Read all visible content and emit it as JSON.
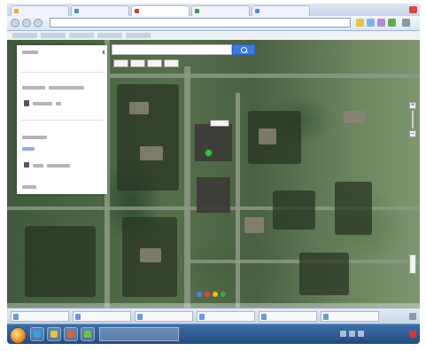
{
  "browser": {
    "tabs": [
      {
        "label": ""
      },
      {
        "label": ""
      },
      {
        "label": ""
      },
      {
        "label": ""
      },
      {
        "label": ""
      }
    ],
    "address": "",
    "accent": "#3c7ae0"
  },
  "map": {
    "search": {
      "placeholder": "",
      "value": ""
    },
    "map_types": [
      "",
      "",
      "",
      ""
    ],
    "label_tag": "",
    "marker_color": "#33c341",
    "zoom_in": "+",
    "zoom_out": "−"
  },
  "side_panel": {
    "header": "",
    "section1_title": "",
    "section1_item": "",
    "section2_title": "",
    "section2_link": "",
    "section2_item": "",
    "footer": ""
  },
  "downloads": [
    {
      "label": ""
    },
    {
      "label": ""
    },
    {
      "label": ""
    },
    {
      "label": ""
    },
    {
      "label": ""
    },
    {
      "label": ""
    }
  ],
  "taskbar": {
    "clock": ""
  }
}
